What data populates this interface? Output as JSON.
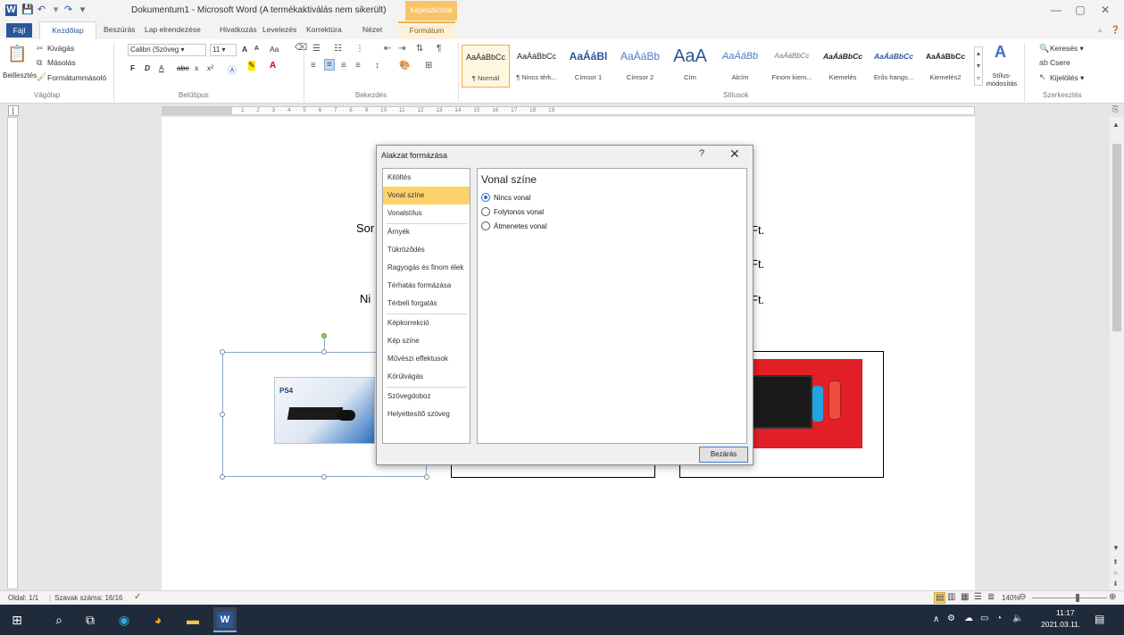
{
  "window": {
    "title": "Dokumentum1 - Microsoft Word (A termékaktiválás nem sikerült)",
    "context_tools": "Képeszközök",
    "controls": [
      "—",
      "▢",
      "✕"
    ]
  },
  "tabs": [
    "Fájl",
    "Kezdőlap",
    "Beszúrás",
    "Lap elrendezése",
    "Hivatkozás",
    "Levelezés",
    "Korrektúra",
    "Nézet",
    "Formátum"
  ],
  "ribbon": {
    "clipboard": {
      "paste": "Beillesztés",
      "cut": "Kivágás",
      "copy": "Másolás",
      "format_painter": "Formátummásoló",
      "label": "Vágólap"
    },
    "font": {
      "family": "Calibri (Szöveg",
      "size": "11",
      "label": "Betűtípus",
      "controls": [
        "A",
        "A",
        "Aa",
        "F",
        "D",
        "A",
        "abc",
        "x",
        "x²"
      ]
    },
    "paragraph": {
      "label": "Bekezdés"
    },
    "styles": {
      "label": "Stílusok",
      "items": [
        {
          "sample": "AaÁáBbCc",
          "name": "¶ Normál"
        },
        {
          "sample": "AaÁáBbCc",
          "name": "¶ Nincs térk..."
        },
        {
          "sample": "AaÁáBl",
          "name": "Címsor 1"
        },
        {
          "sample": "AaÁáBb",
          "name": "Címsor 2"
        },
        {
          "sample": "AaA",
          "name": "Cím"
        },
        {
          "sample": "AaÁáBb",
          "name": "Alcím"
        },
        {
          "sample": "AaÁáBbCc",
          "name": "Finom kiem..."
        },
        {
          "sample": "AaÁáBbCc",
          "name": "Kiemelés"
        },
        {
          "sample": "AaÁáBbCc",
          "name": "Erős hangs..."
        },
        {
          "sample": "AaÁáBbCc",
          "name": "Kiemelés2"
        }
      ],
      "change": "Stílus-módosítás"
    },
    "editing": {
      "label": "Szerkesztés",
      "find": "Keresés",
      "replace": "Csere",
      "select": "Kijelölés"
    }
  },
  "document": {
    "lines": [
      {
        "left": "Sor",
        "right": "Ft."
      },
      {
        "left": "",
        "right": "Ft."
      },
      {
        "left": "Ni",
        "right": "Ft."
      }
    ]
  },
  "dialog": {
    "title": "Alakzat formázása",
    "help": "?",
    "close": "✕",
    "nav": [
      "Kitöltés",
      "Vonal színe",
      "Vonalstílus",
      "Árnyék",
      "Tükröződés",
      "Ragyogás és finom élek",
      "Térhatás formázása",
      "Térbeli forgatás",
      "Képkorrekció",
      "Kép színe",
      "Művészi effektusok",
      "Körülvágás",
      "Szövegdoboz",
      "Helyettesítő szöveg"
    ],
    "active": "Vonal színe",
    "heading": "Vonal színe",
    "options": [
      "Nincs vonal",
      "Folytonos vonal",
      "Átmenetes vonal"
    ],
    "selected_option": "Nincs vonal",
    "close_button": "Bezárás"
  },
  "statusbar": {
    "page": "Oldal: 1/1",
    "words": "Szavak száma: 16/16",
    "zoom": "140%"
  },
  "taskbar": {
    "time": "11:17",
    "date": "2021.03.11."
  },
  "colors": {
    "word_blue": "#2b579a",
    "active_nav": "#fbd36a",
    "taskbar": "#1f2b3b"
  }
}
